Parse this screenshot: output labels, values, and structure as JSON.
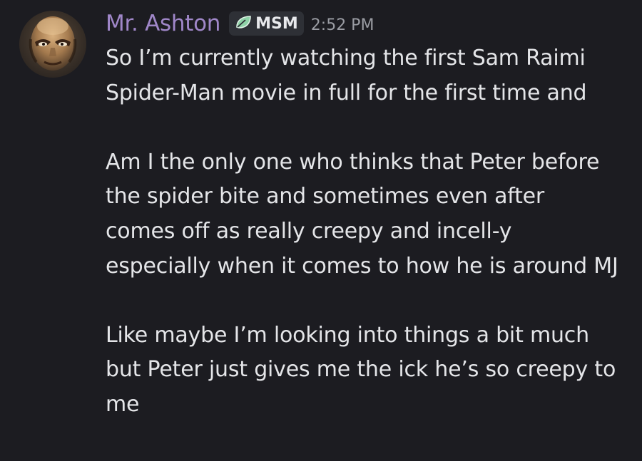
{
  "message": {
    "author": "Mr. Ashton",
    "tag": "MSM",
    "tag_icon": "leaf-icon",
    "timestamp": "2:52 PM",
    "paragraphs": [
      "So I’m currently watching the first Sam Raimi Spider-Man movie in full for the first time and",
      "Am I the only one who thinks that Peter before the spider bite and sometimes even after comes off as really creepy and incell-y especially when it comes to how he is around MJ",
      "Like maybe I’m looking into things a bit much but Peter just gives me the ick he’s so creepy to me"
    ]
  },
  "colors": {
    "background": "#1c1c21",
    "username": "#a087c9",
    "text": "#e4e5e8",
    "timestamp": "#9a9ca3",
    "tag_bg": "#2e3036",
    "tag_icon": "#8fd3a8"
  }
}
